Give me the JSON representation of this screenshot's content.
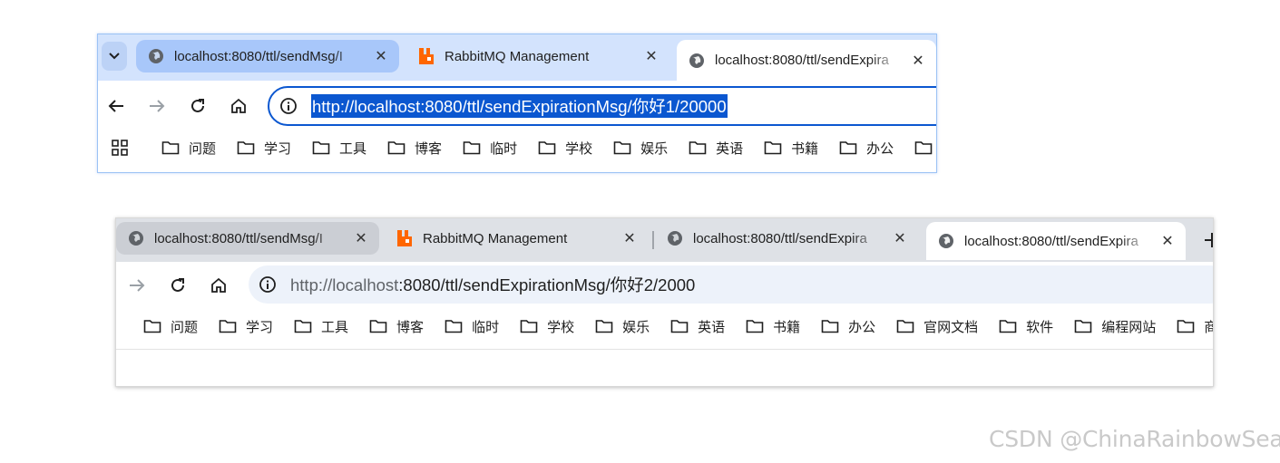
{
  "window1": {
    "tabs": [
      {
        "title": "localhost:8080/ttl/sendMsg/I",
        "icon": "globe-icon",
        "state": "hovered"
      },
      {
        "title": "RabbitMQ Management",
        "icon": "rabbitmq-icon",
        "state": "normal"
      },
      {
        "title": "localhost:8080/ttl/sendExpira",
        "icon": "globe-icon",
        "state": "active"
      }
    ],
    "close_glyph": "✕",
    "url": "http://localhost:8080/ttl/sendExpirationMsg/你好1/20000",
    "url_selected": true
  },
  "window2": {
    "tabs": [
      {
        "title": "localhost:8080/ttl/sendMsg/I",
        "icon": "globe-icon",
        "state": "hovered"
      },
      {
        "title": "RabbitMQ Management",
        "icon": "rabbitmq-icon",
        "state": "normal"
      },
      {
        "title": "localhost:8080/ttl/sendExpira",
        "icon": "globe-icon",
        "state": "normal"
      },
      {
        "title": "localhost:8080/ttl/sendExpira",
        "icon": "globe-icon",
        "state": "active"
      }
    ],
    "close_glyph": "✕",
    "url_host": "http://localhost",
    "url_rest": ":8080/ttl/sendExpirationMsg/你好2/2000",
    "url_selected": false
  },
  "bookmarks": {
    "window1": [
      "问题",
      "学习",
      "工具",
      "博客",
      "临时",
      "学校",
      "娱乐",
      "英语",
      "书籍",
      "办公",
      ""
    ],
    "window2": [
      "问题",
      "学习",
      "工具",
      "博客",
      "临时",
      "学校",
      "娱乐",
      "英语",
      "书籍",
      "办公",
      "官网文档",
      "软件",
      "编程网站",
      "商"
    ]
  },
  "watermark": "CSDN @ChinaRainbowSea",
  "colors": {
    "active_tabstrip": "#d3e3fd",
    "inactive_tabstrip": "#dee1e6",
    "selection": "#0b57d0",
    "rabbitmq_orange": "#ff6600"
  }
}
